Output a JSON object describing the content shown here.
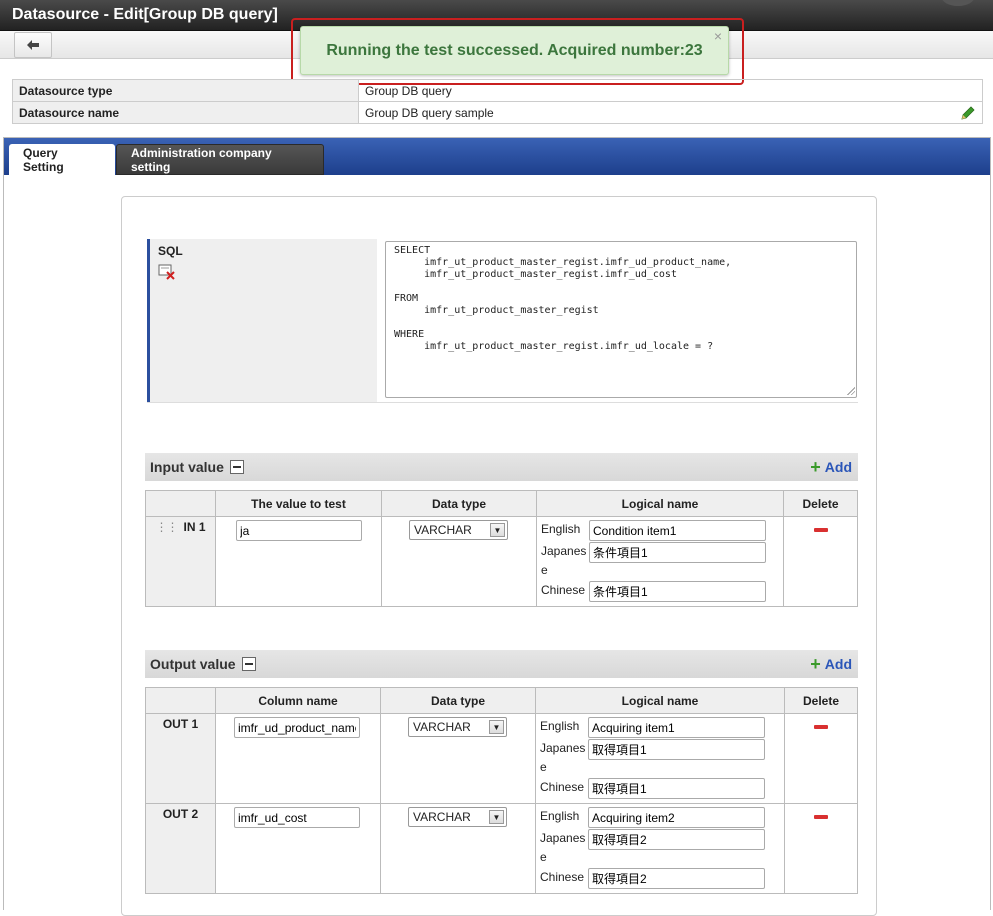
{
  "window": {
    "title": "Datasource - Edit[Group DB query]"
  },
  "toast": {
    "message": "Running the test successed. Acquired number:23",
    "close": "×"
  },
  "info": {
    "type_label": "Datasource type",
    "type_value": "Group DB query",
    "name_label": "Datasource name",
    "name_value": "Group DB query sample"
  },
  "tabs": [
    {
      "label": "Query Setting",
      "active": true
    },
    {
      "label": "Administration company setting",
      "active": false
    }
  ],
  "sql": {
    "label": "SQL",
    "text": "SELECT\n     imfr_ut_product_master_regist.imfr_ud_product_name,\n     imfr_ut_product_master_regist.imfr_ud_cost\n\nFROM\n     imfr_ut_product_master_regist\n\nWHERE\n     imfr_ut_product_master_regist.imfr_ud_locale = ?"
  },
  "input_section": {
    "title": "Input value",
    "add_label": "Add",
    "headers": [
      "",
      "The value to test",
      "Data type",
      "Logical name",
      "Delete"
    ],
    "rows": [
      {
        "id": "IN 1",
        "value": "ja",
        "type": "VARCHAR",
        "lang_en": "English",
        "lang_ja": "Japanese",
        "lang_zh": "Chinese",
        "name_en": "Condition item1",
        "name_ja": "条件項目1",
        "name_zh": "条件項目1"
      }
    ]
  },
  "output_section": {
    "title": "Output value",
    "add_label": "Add",
    "headers": [
      "",
      "Column name",
      "Data type",
      "Logical name",
      "Delete"
    ],
    "rows": [
      {
        "id": "OUT 1",
        "value": "imfr_ud_product_name",
        "type": "VARCHAR",
        "lang_en": "English",
        "lang_ja": "Japanese",
        "lang_zh": "Chinese",
        "name_en": "Acquiring item1",
        "name_ja": "取得項目1",
        "name_zh": "取得項目1"
      },
      {
        "id": "OUT 2",
        "value": "imfr_ud_cost",
        "type": "VARCHAR",
        "lang_en": "English",
        "lang_ja": "Japanese",
        "lang_zh": "Chinese",
        "name_en": "Acquiring item2",
        "name_ja": "取得項目2",
        "name_zh": "取得項目2"
      }
    ]
  },
  "colors": {
    "tab_bar": "#1d3f8c",
    "toast_bg": "#dff0d8",
    "toast_text": "#3c763d",
    "highlight": "#c91f1f",
    "delete": "#d93030",
    "add": "#2a55b8"
  },
  "icons": {
    "back": "arrow-left-icon",
    "edit": "pencil-icon",
    "sql_clear": "clear-icon",
    "add": "plus-icon",
    "delete": "minus-icon",
    "collapse": "collapse-icon"
  }
}
